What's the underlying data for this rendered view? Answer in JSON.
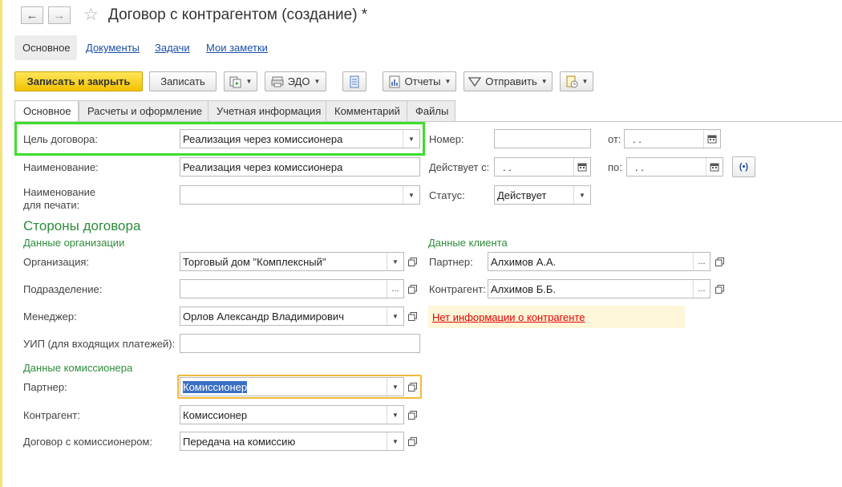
{
  "window": {
    "title": "Договор с контрагентом (создание) *"
  },
  "sections": [
    {
      "label": "Основное"
    },
    {
      "label": "Документы"
    },
    {
      "label": "Задачи"
    },
    {
      "label": "Мои заметки"
    }
  ],
  "toolbar": {
    "save_close": "Записать и закрыть",
    "save": "Записать",
    "edo": "ЭДО",
    "reports": "Отчеты",
    "send": "Отправить"
  },
  "tabs": [
    {
      "label": "Основное"
    },
    {
      "label": "Расчеты и оформление"
    },
    {
      "label": "Учетная информация"
    },
    {
      "label": "Комментарий"
    },
    {
      "label": "Файлы"
    }
  ],
  "form": {
    "purpose": {
      "label": "Цель договора:",
      "value": "Реализация через комиссионера"
    },
    "name": {
      "label": "Наименование:",
      "value": "Реализация через комиссионера"
    },
    "print_name": {
      "label_1": "Наименование",
      "label_2": "для печати:",
      "value": ""
    },
    "number": {
      "label": "Номер:",
      "value": ""
    },
    "from": {
      "label": "от:",
      "value": ".  ."
    },
    "valid_from": {
      "label": "Действует с:",
      "value": ".  ."
    },
    "valid_to": {
      "label": "по:",
      "value": ".  ."
    },
    "status": {
      "label": "Статус:",
      "value": "Действует"
    }
  },
  "parties": {
    "title": "Стороны договора",
    "org_header": "Данные организации",
    "client_header": "Данные клиента",
    "organization": {
      "label": "Организация:",
      "value": "Торговый дом \"Комплексный\""
    },
    "department": {
      "label": "Подразделение:",
      "value": ""
    },
    "manager": {
      "label": "Менеджер:",
      "value": "Орлов Александр Владимирович"
    },
    "uip": {
      "label": "УИП (для входящих платежей):",
      "value": ""
    },
    "partner": {
      "label": "Партнер:",
      "value": "Алхимов А.А."
    },
    "counterparty": {
      "label": "Контрагент:",
      "value": "Алхимов Б.Б."
    },
    "no_info": "Нет информации о контрагенте"
  },
  "commissioner": {
    "header": "Данные комиссионера",
    "partner": {
      "label": "Партнер:",
      "value": "Комиссионер"
    },
    "counterparty": {
      "label": "Контрагент:",
      "value": "Комиссионер"
    },
    "contract": {
      "label": "Договор с комиссионером:",
      "value": "Передача на комиссию"
    }
  },
  "colors": {
    "accent_yellow": "#f2c200",
    "section_green": "#2e8b3a",
    "highlight_green": "#3dde2b",
    "focus_orange": "#f2b93b",
    "link_blue": "#1a4fa8",
    "warning_red": "#e60000"
  },
  "icons": [
    "back-arrow-icon",
    "forward-arrow-icon",
    "favorite-star-icon",
    "create-based-on-icon",
    "edo-icon",
    "list-icon",
    "reports-icon",
    "send-icon",
    "print-icon",
    "calendar-icon",
    "period-icon",
    "open-icon"
  ]
}
